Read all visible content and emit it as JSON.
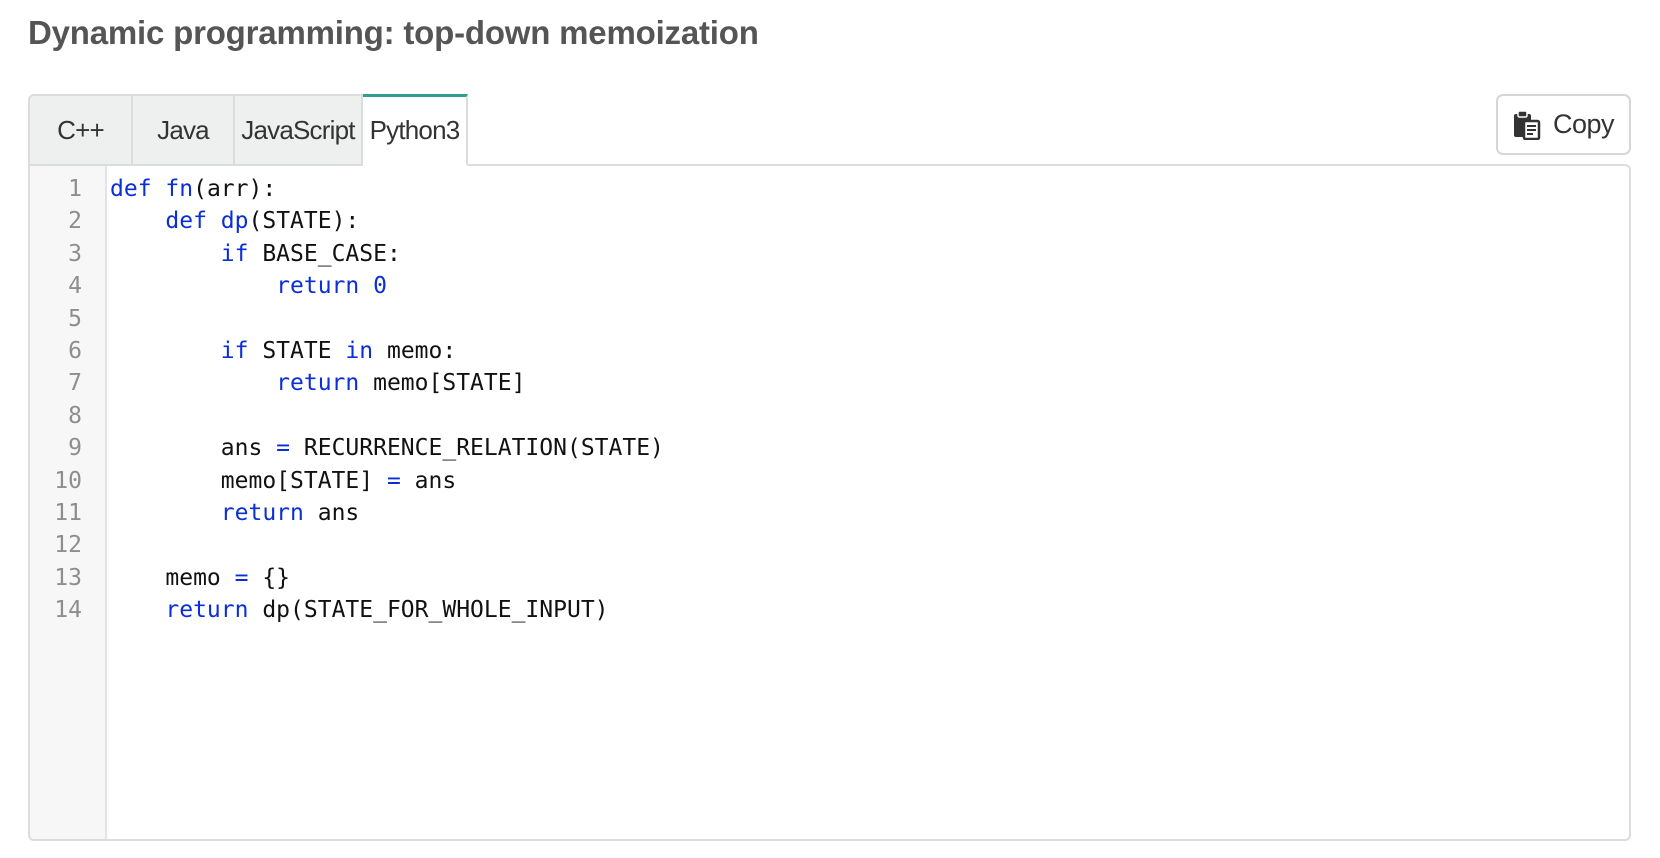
{
  "page": {
    "title": "Dynamic programming: top-down memoization"
  },
  "tabs": [
    {
      "label": "C++",
      "active": false
    },
    {
      "label": "Java",
      "active": false
    },
    {
      "label": "JavaScript",
      "active": false
    },
    {
      "label": "Python3",
      "active": true
    }
  ],
  "copy_button": {
    "label": "Copy",
    "icon": "clipboard-icon"
  },
  "colors": {
    "keyword": "#0b2fd6",
    "text": "#111111",
    "line_number": "#8e8e8e",
    "active_tab_accent": "#2f9e8f",
    "title": "#555555"
  },
  "code": {
    "language": "Python3",
    "lines": [
      {
        "number": "1",
        "tokens": [
          {
            "t": "def",
            "k": "kw"
          },
          {
            "t": " ",
            "k": "plain"
          },
          {
            "t": "fn",
            "k": "fn"
          },
          {
            "t": "(arr):",
            "k": "plain"
          }
        ]
      },
      {
        "number": "2",
        "tokens": [
          {
            "t": "    ",
            "k": "plain"
          },
          {
            "t": "def",
            "k": "kw"
          },
          {
            "t": " ",
            "k": "plain"
          },
          {
            "t": "dp",
            "k": "fn"
          },
          {
            "t": "(STATE):",
            "k": "plain"
          }
        ]
      },
      {
        "number": "3",
        "tokens": [
          {
            "t": "        ",
            "k": "plain"
          },
          {
            "t": "if",
            "k": "kw"
          },
          {
            "t": " BASE_CASE:",
            "k": "plain"
          }
        ]
      },
      {
        "number": "4",
        "tokens": [
          {
            "t": "            ",
            "k": "plain"
          },
          {
            "t": "return",
            "k": "kw"
          },
          {
            "t": " ",
            "k": "plain"
          },
          {
            "t": "0",
            "k": "num"
          }
        ]
      },
      {
        "number": "5",
        "tokens": []
      },
      {
        "number": "6",
        "tokens": [
          {
            "t": "        ",
            "k": "plain"
          },
          {
            "t": "if",
            "k": "kw"
          },
          {
            "t": " STATE ",
            "k": "plain"
          },
          {
            "t": "in",
            "k": "kw"
          },
          {
            "t": " memo:",
            "k": "plain"
          }
        ]
      },
      {
        "number": "7",
        "tokens": [
          {
            "t": "            ",
            "k": "plain"
          },
          {
            "t": "return",
            "k": "kw"
          },
          {
            "t": " memo[STATE]",
            "k": "plain"
          }
        ]
      },
      {
        "number": "8",
        "tokens": []
      },
      {
        "number": "9",
        "tokens": [
          {
            "t": "        ans ",
            "k": "plain"
          },
          {
            "t": "=",
            "k": "op"
          },
          {
            "t": " RECURRENCE_RELATION(STATE)",
            "k": "plain"
          }
        ]
      },
      {
        "number": "10",
        "tokens": [
          {
            "t": "        memo[STATE] ",
            "k": "plain"
          },
          {
            "t": "=",
            "k": "op"
          },
          {
            "t": " ans",
            "k": "plain"
          }
        ]
      },
      {
        "number": "11",
        "tokens": [
          {
            "t": "        ",
            "k": "plain"
          },
          {
            "t": "return",
            "k": "kw"
          },
          {
            "t": " ans",
            "k": "plain"
          }
        ]
      },
      {
        "number": "12",
        "tokens": []
      },
      {
        "number": "13",
        "tokens": [
          {
            "t": "    memo ",
            "k": "plain"
          },
          {
            "t": "=",
            "k": "op"
          },
          {
            "t": " {}",
            "k": "plain"
          }
        ]
      },
      {
        "number": "14",
        "tokens": [
          {
            "t": "    ",
            "k": "plain"
          },
          {
            "t": "return",
            "k": "kw"
          },
          {
            "t": " dp(STATE_FOR_WHOLE_INPUT)",
            "k": "plain"
          }
        ]
      }
    ]
  }
}
